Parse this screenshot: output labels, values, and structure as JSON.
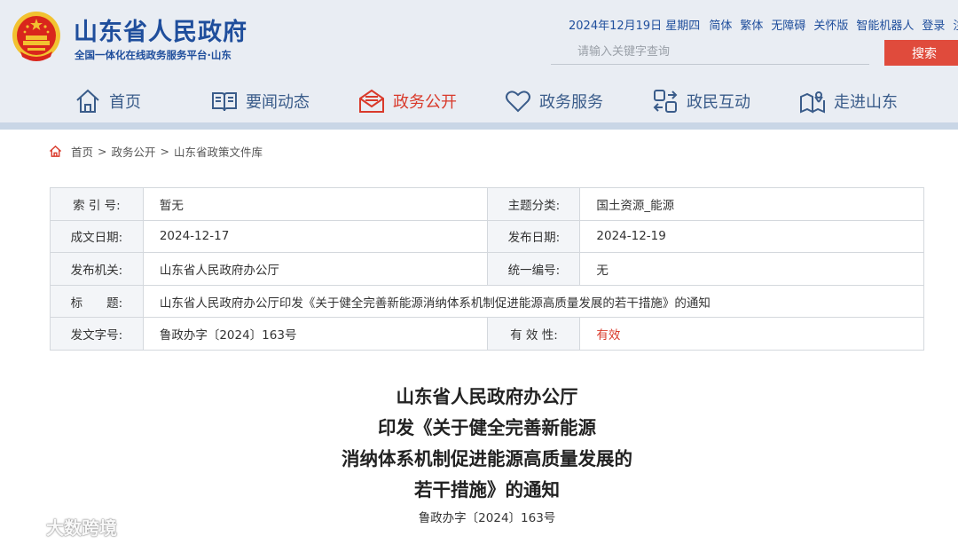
{
  "header": {
    "site_title": "山东省人民政府",
    "site_subtitle": "全国一体化在线政务服务平台·山东",
    "date": "2024年12月19日 星期四",
    "links": [
      "简体",
      "繁体",
      "无障碍",
      "关怀版",
      "智能机器人",
      "登录",
      "注册"
    ],
    "search_placeholder": "请输入关键字查询",
    "search_button": "搜索"
  },
  "nav": {
    "items": [
      {
        "label": "首页",
        "icon": "home-icon"
      },
      {
        "label": "要闻动态",
        "icon": "news-book-icon"
      },
      {
        "label": "政务公开",
        "icon": "mail-open-icon",
        "active": true
      },
      {
        "label": "政务服务",
        "icon": "heart-icon"
      },
      {
        "label": "政民互动",
        "icon": "interaction-icon"
      },
      {
        "label": "走进山东",
        "icon": "map-pin-icon"
      }
    ],
    "accent_color": "#d93a2b",
    "default_color": "#3a5c8a"
  },
  "breadcrumb": {
    "items": [
      "首页",
      "政务公开",
      "山东省政策文件库"
    ],
    "separator": ">"
  },
  "info_table": {
    "rows": [
      [
        "索 引 号:",
        "暂无",
        "主题分类:",
        "国土资源_能源"
      ],
      [
        "成文日期:",
        "2024-12-17",
        "发布日期:",
        "2024-12-19"
      ],
      [
        "发布机关:",
        "山东省人民政府办公厅",
        "统一编号:",
        "无"
      ],
      [
        "标　　题:",
        "山东省人民政府办公厅印发《关于健全完善新能源消纳体系机制促进能源高质量发展的若干措施》的通知"
      ],
      [
        "发文字号:",
        "鲁政办字〔2024〕163号",
        "有 效 性:",
        "有效"
      ]
    ]
  },
  "document": {
    "title_lines": [
      "山东省人民政府办公厅",
      "印发《关于健全完善新能源",
      "消纳体系机制促进能源高质量发展的",
      "若干措施》的通知"
    ],
    "number": "鲁政办字〔2024〕163号"
  },
  "watermark": {
    "text": "大数跨境"
  },
  "colors": {
    "brand_blue": "#1f4e9c",
    "header_bg": "#e9edf3",
    "search_red": "#e04b3c"
  }
}
